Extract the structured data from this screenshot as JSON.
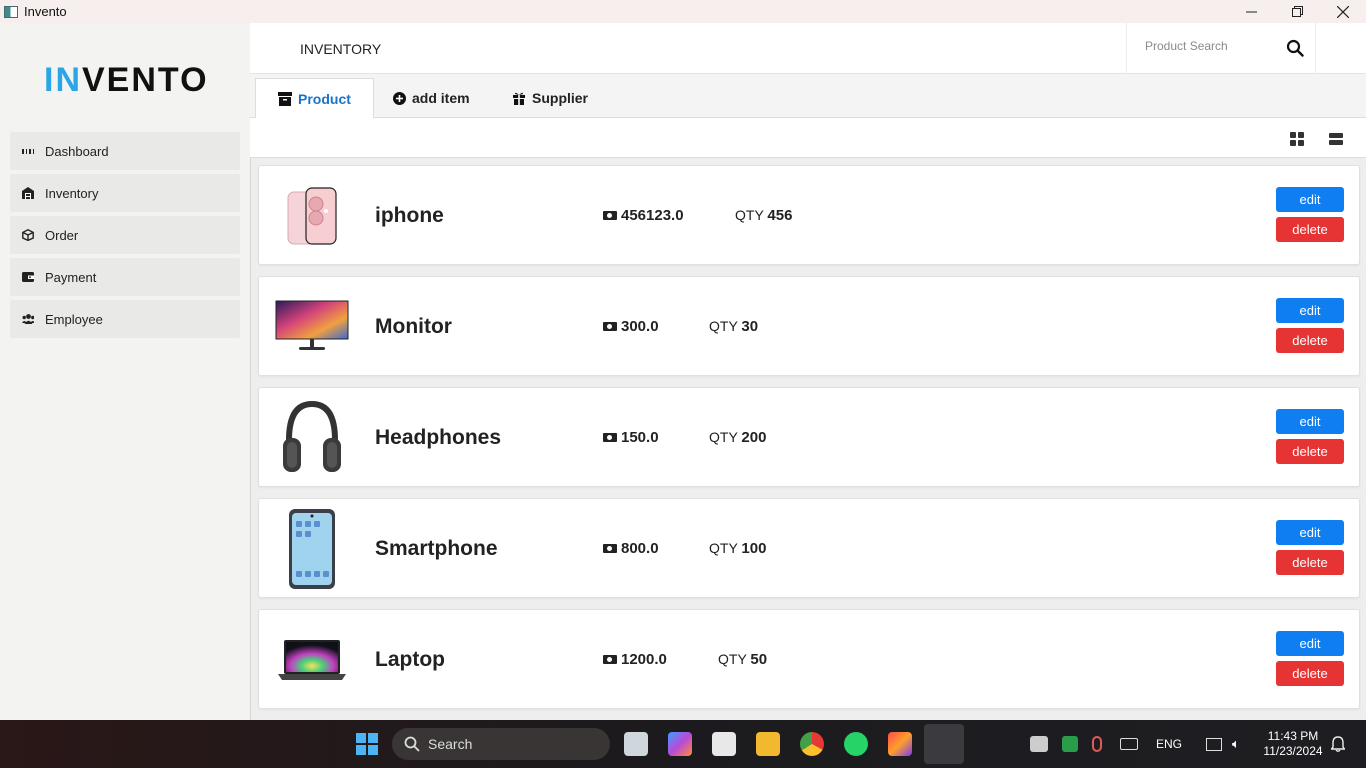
{
  "window": {
    "title": "Invento"
  },
  "sidebar": {
    "logo_accent": "IN",
    "logo_rest": "VENTO",
    "items": [
      {
        "label": "Dashboard",
        "icon": "dashboard-icon"
      },
      {
        "label": "Inventory",
        "icon": "warehouse-icon"
      },
      {
        "label": "Order",
        "icon": "box-icon"
      },
      {
        "label": "Payment",
        "icon": "wallet-icon"
      },
      {
        "label": "Employee",
        "icon": "users-icon"
      }
    ]
  },
  "header": {
    "title": "INVENTORY",
    "search_placeholder": "Product Search"
  },
  "tabs": [
    {
      "label": "Product",
      "icon": "archive-icon",
      "active": true
    },
    {
      "label": "add item",
      "icon": "plus-circle-icon",
      "active": false
    },
    {
      "label": "Supplier",
      "icon": "gift-icon",
      "active": false
    }
  ],
  "products": [
    {
      "name": "iphone",
      "price": "456123.0",
      "qty_label": "QTY",
      "qty": "456",
      "image": "iphone-image"
    },
    {
      "name": "Monitor",
      "price": "300.0",
      "qty_label": "QTY",
      "qty": "30",
      "image": "monitor-image"
    },
    {
      "name": "Headphones",
      "price": "150.0",
      "qty_label": "QTY",
      "qty": "200",
      "image": "headphones-image"
    },
    {
      "name": "Smartphone",
      "price": "800.0",
      "qty_label": "QTY",
      "qty": "100",
      "image": "smartphone-image"
    },
    {
      "name": "Laptop",
      "price": "1200.0",
      "qty_label": "QTY",
      "qty": "50",
      "image": "laptop-image"
    }
  ],
  "actions": {
    "edit": "edit",
    "delete": "delete"
  },
  "taskbar": {
    "search_label": "Search",
    "language": "ENG",
    "time": "11:43 PM",
    "date": "11/23/2024"
  },
  "colors": {
    "accent": "#2aa6e6",
    "primary": "#0f7ef0",
    "danger": "#e53433",
    "tab_active": "#1a73c9"
  }
}
